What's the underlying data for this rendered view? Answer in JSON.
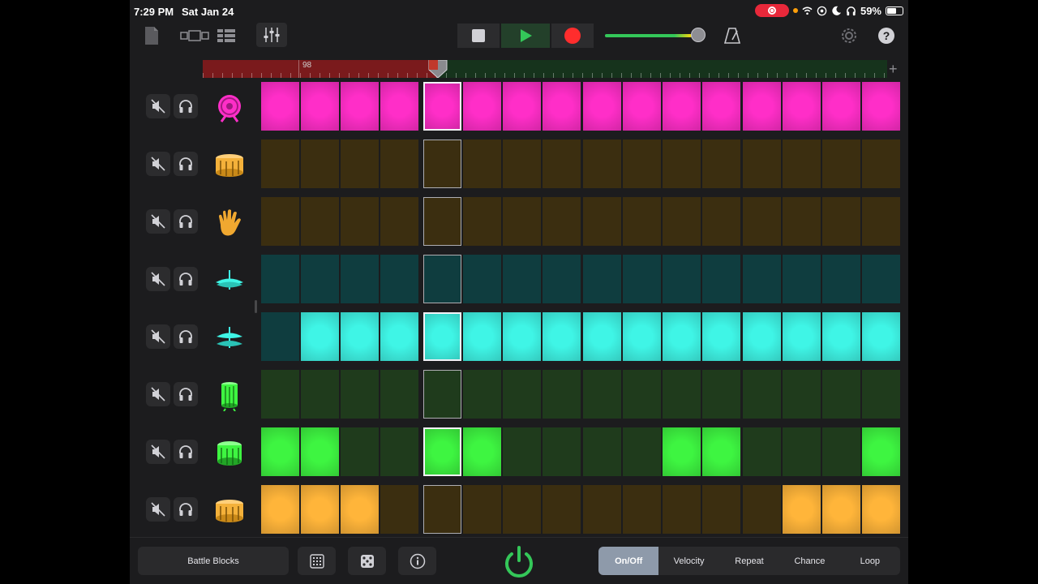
{
  "status": {
    "time": "7:29 PM",
    "date": "Sat Jan 24",
    "battery": "59%"
  },
  "toolbar": {
    "icons": [
      "document-icon",
      "view-toggle-icon",
      "tracks-view-icon",
      "mixer-icon",
      "stop-icon",
      "play-icon",
      "record-icon",
      "metronome-icon",
      "settings-icon",
      "help-icon"
    ],
    "master_volume": 0.92
  },
  "timeline": {
    "bar_number": "98"
  },
  "colors": {
    "pink_on": "#ff2ec8",
    "pink_off": "#5a1f4c",
    "gold_on": "#ffb53a",
    "gold_off": "#3b2e10",
    "cyan_on": "#3ff5e6",
    "cyan_off": "#0f3d3f",
    "green_on": "#3ef541",
    "green_off": "#1f3b1c",
    "accent_green": "#34c759"
  },
  "current_step": 5,
  "tracks": [
    {
      "name": "kick",
      "icon": "kick-drum-icon",
      "color": "pink",
      "steps": [
        1,
        1,
        1,
        1,
        1,
        1,
        1,
        1,
        1,
        1,
        1,
        1,
        1,
        1,
        1,
        1
      ]
    },
    {
      "name": "snare",
      "icon": "snare-drum-icon",
      "color": "gold",
      "steps": [
        0,
        0,
        0,
        0,
        0,
        0,
        0,
        0,
        0,
        0,
        0,
        0,
        0,
        0,
        0,
        0
      ]
    },
    {
      "name": "clap",
      "icon": "clap-hand-icon",
      "color": "gold",
      "steps": [
        0,
        0,
        0,
        0,
        0,
        0,
        0,
        0,
        0,
        0,
        0,
        0,
        0,
        0,
        0,
        0
      ]
    },
    {
      "name": "closed-hihat",
      "icon": "hihat-closed-icon",
      "color": "cyan",
      "steps": [
        0,
        0,
        0,
        0,
        0,
        0,
        0,
        0,
        0,
        0,
        0,
        0,
        0,
        0,
        0,
        0
      ]
    },
    {
      "name": "open-hihat",
      "icon": "hihat-open-icon",
      "color": "cyan",
      "steps": [
        0,
        1,
        1,
        1,
        1,
        1,
        1,
        1,
        1,
        1,
        1,
        1,
        1,
        1,
        1,
        1
      ]
    },
    {
      "name": "tom",
      "icon": "tom-drum-icon",
      "color": "green",
      "steps": [
        0,
        0,
        0,
        0,
        0,
        0,
        0,
        0,
        0,
        0,
        0,
        0,
        0,
        0,
        0,
        0
      ]
    },
    {
      "name": "floor-tom",
      "icon": "floor-tom-icon",
      "color": "green",
      "steps": [
        1,
        1,
        0,
        0,
        1,
        1,
        0,
        0,
        0,
        0,
        1,
        1,
        0,
        0,
        0,
        1
      ]
    },
    {
      "name": "snare-2",
      "icon": "snare-drum-icon",
      "color": "gold",
      "steps": [
        1,
        1,
        1,
        0,
        0,
        0,
        0,
        0,
        0,
        0,
        0,
        0,
        0,
        1,
        1,
        1
      ]
    }
  ],
  "bottom": {
    "pattern_name": "Battle Blocks",
    "modes": [
      "On/Off",
      "Velocity",
      "Repeat",
      "Chance",
      "Loop"
    ],
    "selected_mode": "On/Off"
  }
}
